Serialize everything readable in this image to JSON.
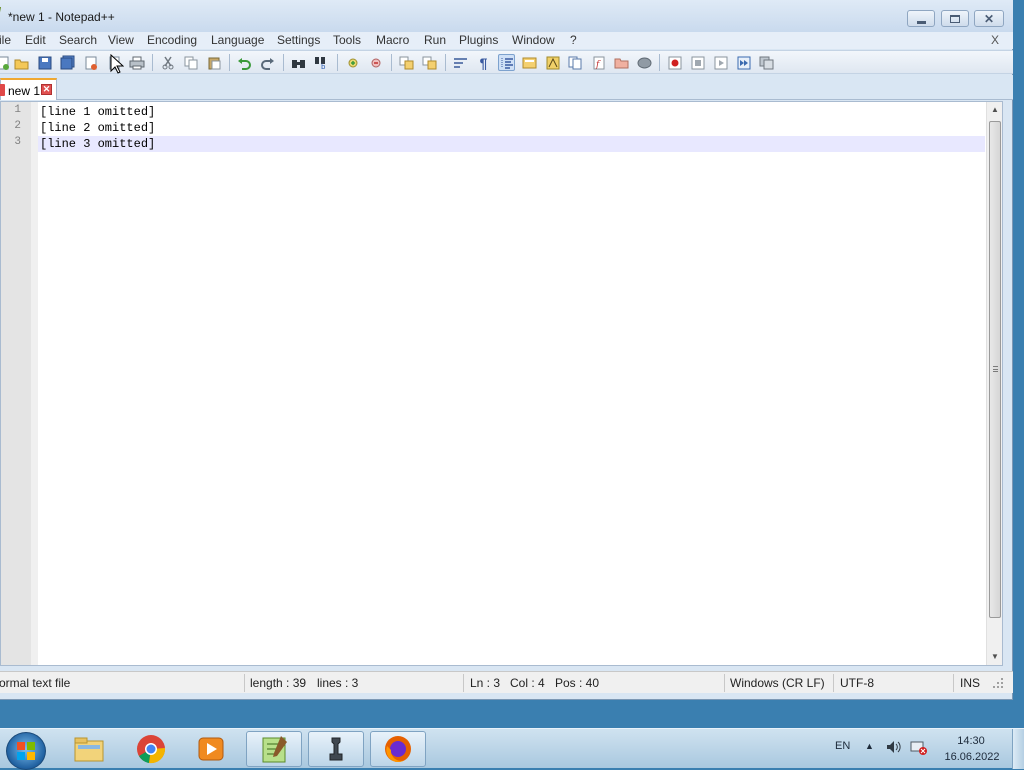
{
  "window": {
    "title": "*new 1 - Notepad++"
  },
  "menubar": {
    "items": [
      {
        "label": "ile"
      },
      {
        "label": "Edit"
      },
      {
        "label": "Search"
      },
      {
        "label": "View"
      },
      {
        "label": "Encoding"
      },
      {
        "label": "Language"
      },
      {
        "label": "Settings"
      },
      {
        "label": "Tools"
      },
      {
        "label": "Macro"
      },
      {
        "label": "Run"
      },
      {
        "label": "Plugins"
      },
      {
        "label": "Window"
      },
      {
        "label": "?"
      }
    ],
    "close_doc": "X"
  },
  "toolbar": {
    "icons": [
      "new-file-icon",
      "open-file-icon",
      "save-icon",
      "save-all-icon",
      "close-file-icon",
      "close-all-icon",
      "print-icon",
      "cut-icon",
      "copy-icon",
      "paste-icon",
      "undo-icon",
      "redo-icon",
      "find-icon",
      "replace-icon",
      "zoom-in-icon",
      "zoom-out-icon",
      "sync-vertical-icon",
      "sync-horizontal-icon",
      "word-wrap-icon",
      "show-all-characters-icon",
      "indent-guide-icon",
      "user-defined-language-icon",
      "document-map-icon",
      "document-list-icon",
      "function-list-icon",
      "folder-as-workspace-icon",
      "monitoring-icon",
      "record-macro-icon",
      "stop-recording-icon",
      "playback-macro-icon",
      "run-macro-multiple-icon",
      "save-macro-icon"
    ]
  },
  "tabs": [
    {
      "label": "new 1",
      "modified": true
    }
  ],
  "editor": {
    "lines": [
      {
        "number": "1",
        "text": "[line 1 omitted]"
      },
      {
        "number": "2",
        "text": "[line 2 omitted]"
      },
      {
        "number": "3",
        "text": "[line 3 omitted]"
      }
    ],
    "current_line": 3
  },
  "statusbar": {
    "file_type": "ormal text file",
    "length": "length : 39",
    "lines": "lines : 3",
    "ln": "Ln : 3",
    "col": "Col : 4",
    "pos": "Pos : 40",
    "eol": "Windows (CR LF)",
    "encoding": "UTF-8",
    "mode": "INS"
  },
  "taskbar": {
    "apps": [
      "windows-explorer",
      "google-chrome",
      "media-player",
      "notepad-plus-plus",
      "chess-app",
      "firefox"
    ],
    "tray": {
      "language": "EN",
      "time": "14:30",
      "date": "16.06.2022"
    }
  },
  "colors": {
    "current_line_highlight": "#e8e8ff",
    "tab_accent": "#f0a830",
    "titlebar": "#dfeaf6"
  }
}
